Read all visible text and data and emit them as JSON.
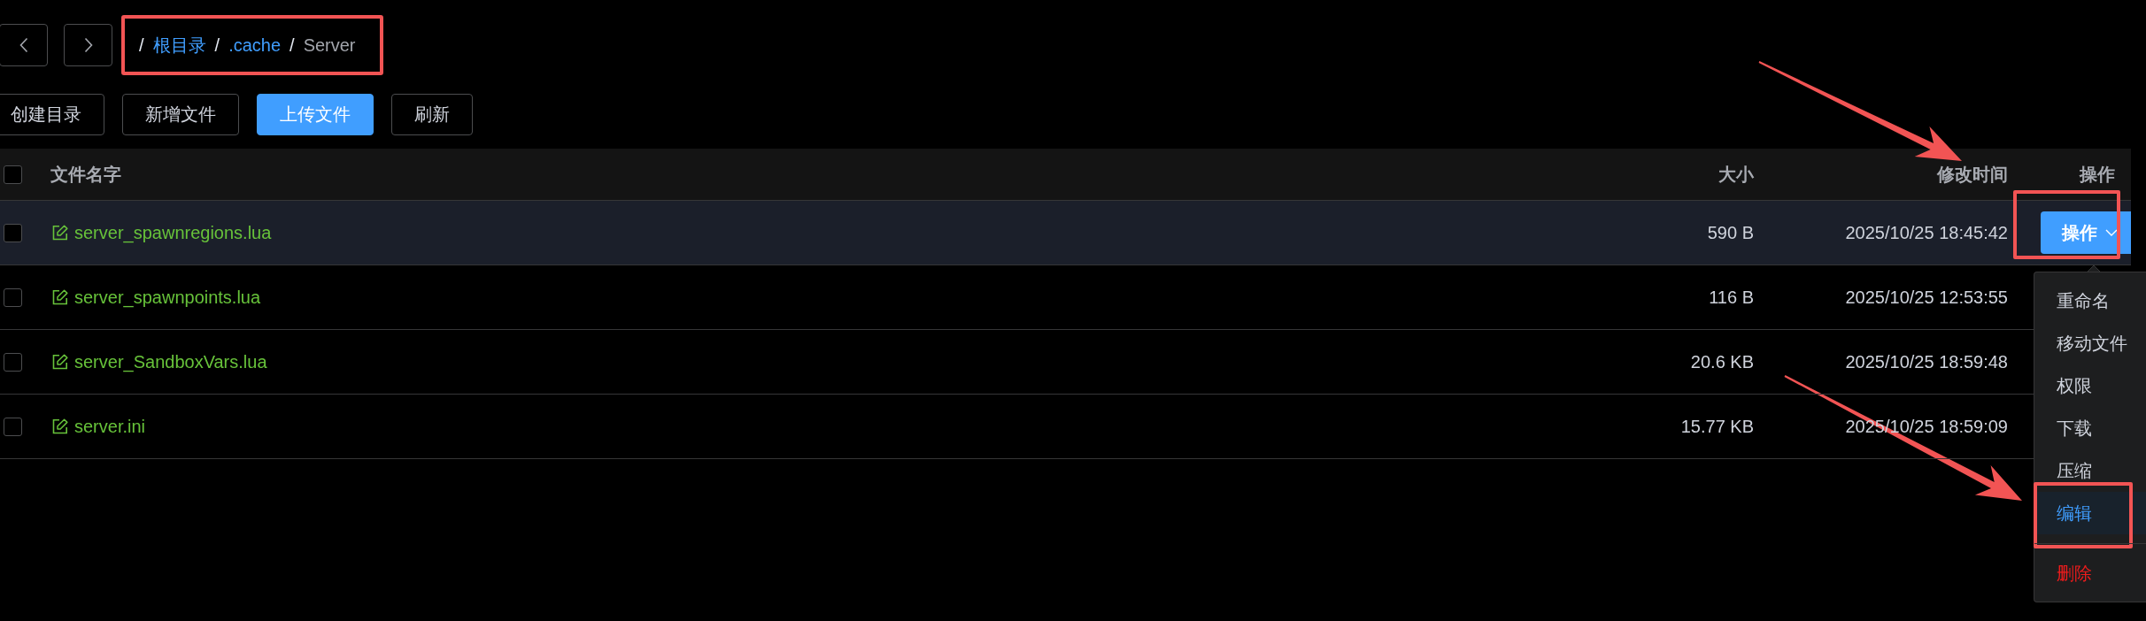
{
  "breadcrumb": {
    "annotated": true,
    "items": [
      {
        "separator": "/",
        "label": "根目录",
        "kind": "link"
      },
      {
        "separator": "/",
        "label": ".cache",
        "kind": "link"
      },
      {
        "separator": "/",
        "label": "Server",
        "kind": "current"
      }
    ]
  },
  "toolbar": {
    "buttons": [
      {
        "label": "创建目录",
        "kind": "default"
      },
      {
        "label": "新增文件",
        "kind": "default"
      },
      {
        "label": "上传文件",
        "kind": "primary"
      },
      {
        "label": "刷新",
        "kind": "default"
      }
    ]
  },
  "table": {
    "select_all": {
      "checked": false
    },
    "columns": [
      "文件名字",
      "大小",
      "修改时间",
      "操作"
    ],
    "rows": [
      {
        "checked": false,
        "hovered": true,
        "name": "server_spawnregions.lua",
        "size": "590 B",
        "modified": "2025/10/25 18:45:42",
        "action_button": {
          "label": "操作",
          "annotated": true
        }
      },
      {
        "checked": false,
        "hovered": false,
        "name": "server_spawnpoints.lua",
        "size": "116 B",
        "modified": "2025/10/25 12:53:55"
      },
      {
        "checked": false,
        "hovered": false,
        "name": "server_SandboxVars.lua",
        "size": "20.6 KB",
        "modified": "2025/10/25 18:59:48"
      },
      {
        "checked": false,
        "hovered": false,
        "name": "server.ini",
        "size": "15.77 KB",
        "modified": "2025/10/25 18:59:09"
      }
    ]
  },
  "action_menu": {
    "items": [
      {
        "label": "重命名",
        "kind": "normal",
        "hovered": false,
        "divided": false,
        "annotated": false
      },
      {
        "label": "移动文件",
        "kind": "normal",
        "hovered": false,
        "divided": false,
        "annotated": false
      },
      {
        "label": "权限",
        "kind": "normal",
        "hovered": false,
        "divided": false,
        "annotated": false
      },
      {
        "label": "下载",
        "kind": "normal",
        "hovered": false,
        "divided": false,
        "annotated": false
      },
      {
        "label": "压缩",
        "kind": "normal",
        "hovered": false,
        "divided": false,
        "annotated": false
      },
      {
        "label": "编辑",
        "kind": "normal",
        "hovered": true,
        "divided": false,
        "annotated": true
      },
      {
        "label": "删除",
        "kind": "danger",
        "hovered": false,
        "divided": true,
        "annotated": false
      }
    ]
  }
}
